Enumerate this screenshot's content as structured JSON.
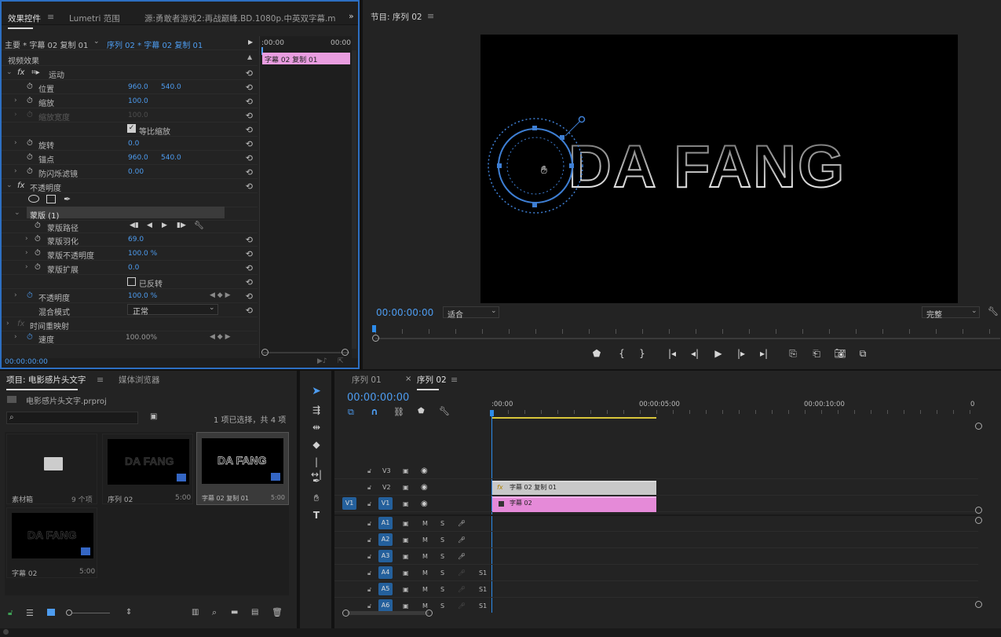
{
  "effect_controls": {
    "tabs": [
      "效果控件",
      "Lumetri 范围",
      "源:勇敢者游戏2:再战巅峰.BD.1080p.中英双字幕.mp4"
    ],
    "tab_menu_icon": "hamburger-icon",
    "expand_icon": "double-chevron-right-icon",
    "master_clip": "主要 * 字幕 02 复制 01",
    "sequence_clip": "序列 02 * 字幕 02 复制 01",
    "ruler_start": ":00:00",
    "ruler_end": "00:00",
    "clip_bar_label": "字幕 02 复制 01",
    "video_effects_label": "视频效果",
    "rows": [
      {
        "label": "运动",
        "fx": "fx",
        "type": "group"
      },
      {
        "label": "位置",
        "v1": "960.0",
        "v2": "540.0",
        "stopwatch": true
      },
      {
        "label": "缩放",
        "v1": "100.0",
        "stopwatch": true
      },
      {
        "label": "缩放宽度",
        "v1": "100.0",
        "stopwatch": true,
        "disabled": true
      },
      {
        "label": "等比缩放",
        "checkbox": true,
        "checked": true
      },
      {
        "label": "旋转",
        "v1": "0.0",
        "stopwatch": true
      },
      {
        "label": "锚点",
        "v1": "960.0",
        "v2": "540.0",
        "stopwatch": true
      },
      {
        "label": "防闪烁滤镜",
        "v1": "0.00",
        "stopwatch": true
      },
      {
        "label": "不透明度",
        "fx": "fx",
        "type": "group"
      },
      {
        "label": "",
        "type": "shape-tools"
      },
      {
        "label": "蒙版 (1)",
        "type": "mask"
      },
      {
        "label": "蒙版路径",
        "type": "mask-path"
      },
      {
        "label": "蒙版羽化",
        "v1": "69.0",
        "stopwatch": true
      },
      {
        "label": "蒙版不透明度",
        "v1": "100.0 %",
        "stopwatch": true
      },
      {
        "label": "蒙版扩展",
        "v1": "0.0",
        "stopwatch": true
      },
      {
        "label": "已反转",
        "checkbox": true,
        "checked": false
      },
      {
        "label": "不透明度",
        "v1": "100.0 %",
        "stopwatch": true,
        "keyframe": true
      },
      {
        "label": "混合模式",
        "select": "正常"
      },
      {
        "label": "时间重映射",
        "fx": "fx",
        "type": "group",
        "disabled": true
      },
      {
        "label": "速度",
        "v1": "100.00%",
        "stopwatch": true,
        "keyframe": true
      }
    ],
    "timecode": "00:00:00:00"
  },
  "program_monitor": {
    "title": "节目: 序列 02",
    "menu_icon": "hamburger-icon",
    "video_text": "DA FANG",
    "timecode": "00:00:00:00",
    "zoom": "适合",
    "resolution": "完整",
    "settings_icon": "wrench-icon",
    "controls": [
      "marker-icon",
      "mark-in-icon",
      "mark-out-icon",
      "go-to-in-icon",
      "step-back-icon",
      "play-icon",
      "step-forward-icon",
      "go-to-out-icon",
      "insert-icon",
      "overwrite-icon",
      "export-frame-icon",
      "compare-icon"
    ]
  },
  "project": {
    "tabs": [
      "项目: 电影感片头文字",
      "媒体浏览器"
    ],
    "project_file": "电影感片头文字.prproj",
    "selection_info": "1 项已选择，共 4 项",
    "items": [
      {
        "name": "素材箱",
        "meta": "9 个项",
        "kind": "bin"
      },
      {
        "name": "序列 02",
        "meta": "5:00",
        "kind": "sequence",
        "thumb_text": "DA FANG"
      },
      {
        "name": "字幕 02 复制 01",
        "meta": "5:00",
        "kind": "title",
        "thumb_text": "DA FANG",
        "selected": true
      },
      {
        "name": "字幕 02",
        "meta": "5:00",
        "kind": "title",
        "thumb_text": "DA FANG"
      }
    ]
  },
  "tools": [
    "selection-tool-icon",
    "track-select-tool-icon",
    "ripple-edit-tool-icon",
    "razor-tool-icon",
    "slip-tool-icon",
    "pen-tool-icon",
    "hand-tool-icon",
    "type-tool-icon"
  ],
  "timeline": {
    "tabs": [
      "序列 01",
      "序列 02"
    ],
    "timecode": "00:00:00:00",
    "ruler": [
      ":00:00",
      "00:00:05:00",
      "00:00:10:00",
      "0"
    ],
    "video_tracks": [
      "V3",
      "V2",
      "V1"
    ],
    "source_patch": "V1",
    "audio_tracks": [
      "A1",
      "A2",
      "A3",
      "A4",
      "A5",
      "A6"
    ],
    "audio_levels": [
      "",
      "",
      "",
      "S1",
      "S1",
      "S1"
    ],
    "mute_label": "M",
    "solo_label": "S",
    "clips": [
      {
        "label": "字幕 02 复制 01",
        "track": "V2",
        "fx": "fx"
      },
      {
        "label": "字幕 02",
        "track": "V1"
      }
    ],
    "colors": {
      "clip_v2": "#c8c8c8",
      "clip_v1": "#e58ad8",
      "accent": "#2d8ceb"
    }
  }
}
